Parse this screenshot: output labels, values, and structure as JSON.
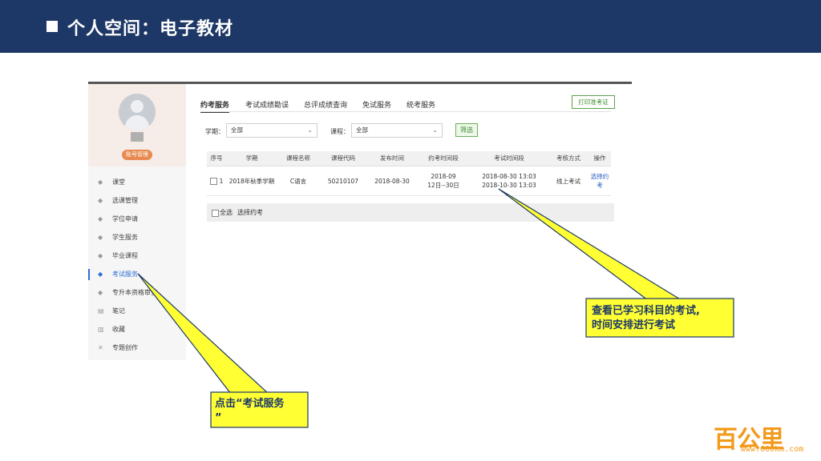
{
  "slide": {
    "title": "个人空间：电子教材"
  },
  "sidebar": {
    "account_button": "账号管理",
    "items": [
      {
        "label": "课堂",
        "icon": "graduation-cap-icon"
      },
      {
        "label": "选课管理",
        "icon": "graduation-cap-icon"
      },
      {
        "label": "学位申请",
        "icon": "graduation-cap-icon"
      },
      {
        "label": "学生服务",
        "icon": "graduation-cap-icon"
      },
      {
        "label": "毕业课程",
        "icon": "graduation-cap-icon"
      },
      {
        "label": "考试服务",
        "icon": "graduation-cap-icon",
        "active": true
      },
      {
        "label": "专升本资格审查",
        "icon": "graduation-cap-icon"
      },
      {
        "label": "笔记",
        "icon": "notebook-icon"
      },
      {
        "label": "收藏",
        "icon": "bookmark-icon"
      },
      {
        "label": "专题创作",
        "icon": "tools-icon"
      }
    ]
  },
  "tabs": [
    {
      "label": "约考服务",
      "active": true
    },
    {
      "label": "考试成绩勘误"
    },
    {
      "label": "总评成绩查询"
    },
    {
      "label": "免试服务"
    },
    {
      "label": "统考服务"
    }
  ],
  "print_button": "打印准考证",
  "filters": {
    "term_label": "学期：",
    "term_value": "全部",
    "course_label": "课程：",
    "course_value": "全部",
    "filter_button": "筛选"
  },
  "table": {
    "headers": [
      "序号",
      "学期",
      "课程名称",
      "课程代码",
      "发布时间",
      "约考时间段",
      "考试时间段",
      "考核方式",
      "操作"
    ],
    "rows": [
      {
        "index": "1",
        "term": "2018年秋季学期",
        "course": "C语言",
        "code": "50210107",
        "publish": "2018-08-30",
        "book_line1": "2018-09",
        "book_line2": "12日--30日",
        "exam_line1": "2018-08-30 13:03",
        "exam_line2": "2018-10-30 13:03",
        "method": "线上考试",
        "action": "选择约考"
      }
    ]
  },
  "footer": {
    "select_all": "全选",
    "batch_action": "选择约考"
  },
  "callouts": {
    "right": {
      "line1": "查看已学习科目的考试,",
      "line2": "时间安排进行考试"
    },
    "left": {
      "line1": "点击“考试服务",
      "line2": "”"
    }
  },
  "colors": {
    "header_bg": "#1d3866",
    "callout_fill": "#ffff33",
    "logo": "#f39a1b"
  },
  "logo": {
    "main": "百公里",
    "url": "www.600km.com"
  }
}
